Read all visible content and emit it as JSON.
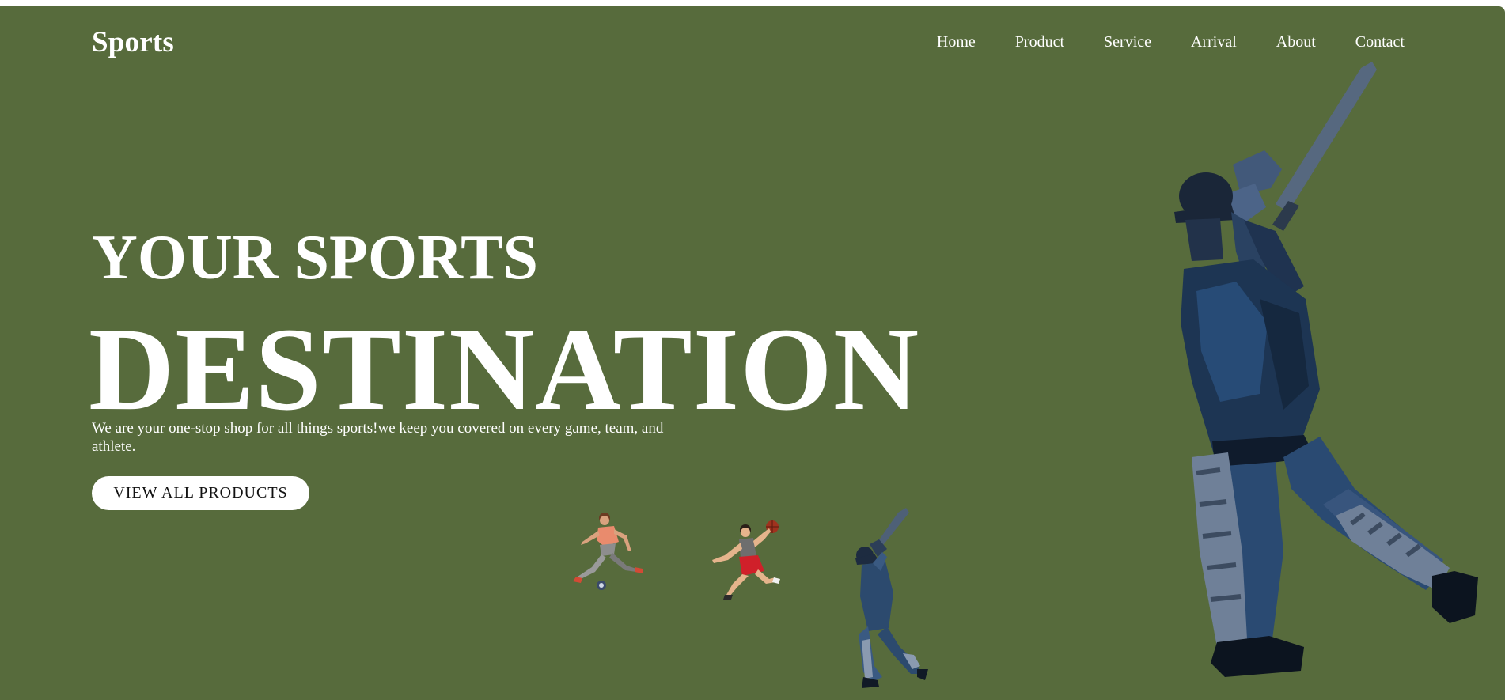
{
  "brand": {
    "logo": "Sports"
  },
  "nav": {
    "items": [
      "Home",
      "Product",
      "Service",
      "Arrival",
      "About",
      "Contact"
    ]
  },
  "hero": {
    "line1": "YOUR SPORTS",
    "line2": "DESTINATION",
    "description": "We are your one-stop shop for all things sports!we keep you covered on every game, team, and athlete.",
    "cta_label": "VIEW ALL PRODUCTS"
  },
  "images": [
    {
      "name": "footballer-image",
      "alt": "soccer player kicking ball"
    },
    {
      "name": "basketball-player-image",
      "alt": "basketball player jumping"
    },
    {
      "name": "cricketer-small-image",
      "alt": "cricket batsman small"
    },
    {
      "name": "cricketer-large-image",
      "alt": "cricket batsman large"
    }
  ],
  "colors": {
    "background": "#576b3c",
    "text": "#ffffff",
    "button_bg": "#ffffff",
    "button_text": "#111111"
  }
}
